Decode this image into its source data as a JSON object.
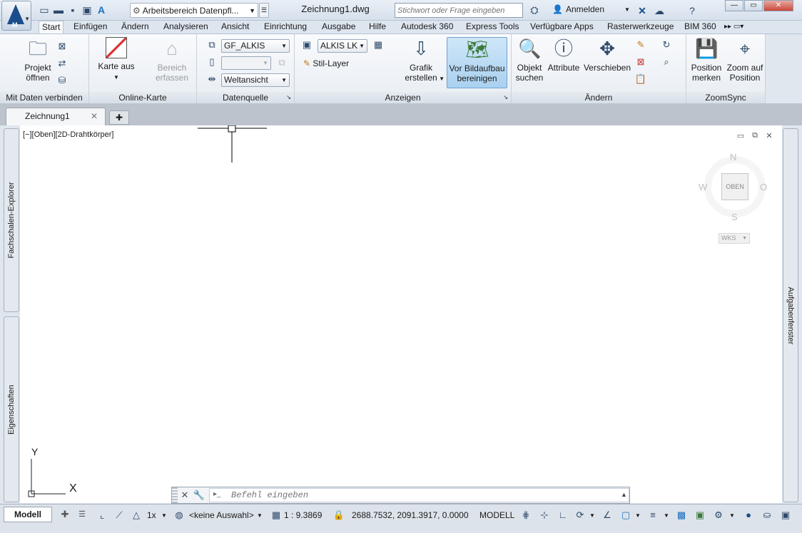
{
  "titlebar": {
    "app_letter": "M",
    "workspace": "Arbeitsbereich Datenpfl...",
    "document": "Zeichnung1.dwg",
    "search_placeholder": "Stichwort oder Frage eingeben",
    "signin": "Anmelden"
  },
  "tabs": [
    "Start",
    "Einfügen",
    "Ändern",
    "Analysieren",
    "Ansicht",
    "Einrichtung",
    "Ausgabe",
    "Hilfe",
    "Autodesk 360",
    "Express Tools",
    "Verfügbare Apps",
    "Rasterwerkzeuge",
    "BIM 360"
  ],
  "ribbon": {
    "panel1": {
      "title": "Mit Daten verbinden",
      "open_l1": "Projekt",
      "open_l2": "öffnen"
    },
    "panel2": {
      "title": "Online-Karte",
      "map_l1": "Karte aus",
      "area_l1": "Bereich",
      "area_l2": "erfassen"
    },
    "panel3": {
      "title": "Datenquelle",
      "combo1": "GF_ALKIS",
      "combo2": "",
      "combo3": "Weltansicht"
    },
    "panel4": {
      "title": "Anzeigen",
      "combo": "ALKIS LK",
      "style_layer": "Stil-Layer",
      "graphic_l1": "Grafik",
      "graphic_l2": "erstellen",
      "clean_l1": "Vor Bildaufbau",
      "clean_l2": "bereinigen"
    },
    "panel5": {
      "title": "Ändern",
      "obj_l1": "Objekt",
      "obj_l2": "suchen",
      "attr": "Attribute",
      "move": "Verschieben"
    },
    "panel6": {
      "title": "ZoomSync",
      "pos_l1": "Position",
      "pos_l2": "merken",
      "zoom_l1": "Zoom auf",
      "zoom_l2": "Position"
    }
  },
  "doc_tab": "Zeichnung1",
  "viewport": {
    "controls": "[−][Oben][2D-Drahtkörper]",
    "cube_face": "OBEN",
    "north": "N",
    "south": "S",
    "west": "W",
    "east": "O",
    "wcs": "WKS"
  },
  "ucs": {
    "x": "X",
    "y": "Y"
  },
  "palettes": {
    "left_top": "Fachschalen-Explorer",
    "left_bottom": "Eigenschaften",
    "right": "Aufgabenfenster"
  },
  "command": {
    "placeholder": "Befehl eingeben"
  },
  "status": {
    "model_tab": "Modell",
    "scale": "1x",
    "selection": "<keine Auswahl>",
    "ratio": "1 : 9.3869",
    "coords": "2688.7532, 2091.3917, 0.0000",
    "mode": "MODELL"
  }
}
